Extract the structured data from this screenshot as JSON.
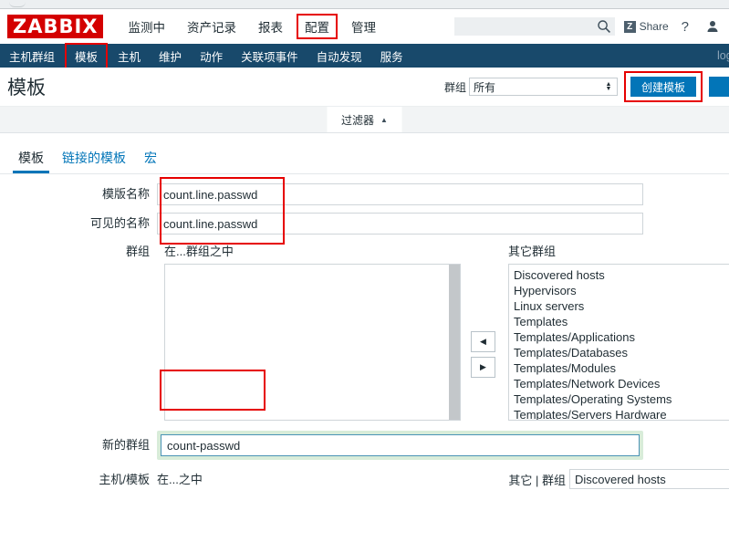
{
  "browser": {
    "chrome_visible": true
  },
  "header": {
    "logo": "ZABBIX",
    "menu": [
      {
        "label": "监测中",
        "highlighted": false
      },
      {
        "label": "资产记录",
        "highlighted": false
      },
      {
        "label": "报表",
        "highlighted": false
      },
      {
        "label": "配置",
        "highlighted": true
      },
      {
        "label": "管理",
        "highlighted": false
      }
    ],
    "search": {
      "value": "",
      "placeholder": ""
    },
    "share_label": "Share",
    "share_badge": "Z",
    "help_label": "?",
    "icons": {
      "search": "search-icon",
      "help": "question-mark-icon",
      "user": "user-icon"
    }
  },
  "subnav": {
    "items": [
      {
        "label": "主机群组",
        "active": false
      },
      {
        "label": "模板",
        "active": true
      },
      {
        "label": "主机",
        "active": false
      },
      {
        "label": "维护",
        "active": false
      },
      {
        "label": "动作",
        "active": false
      },
      {
        "label": "关联项事件",
        "active": false
      },
      {
        "label": "自动发现",
        "active": false
      },
      {
        "label": "服务",
        "active": false
      }
    ],
    "logout_label": "logout"
  },
  "title_row": {
    "page_title": "模板",
    "group_label": "群组",
    "group_value": "所有",
    "create_button": "创建模板"
  },
  "filter": {
    "label": "过滤器",
    "toggle_glyph": "▲"
  },
  "tabs": [
    {
      "label": "模板",
      "active": true
    },
    {
      "label": "链接的模板",
      "active": false
    },
    {
      "label": "宏",
      "active": false
    }
  ],
  "form": {
    "template_name": {
      "label": "模版名称",
      "value": "count.line.passwd"
    },
    "visible_name": {
      "label": "可见的名称",
      "value": "count.line.passwd"
    },
    "groups": {
      "label": "群组",
      "in_groups_title": "在...群组之中",
      "other_groups_title": "其它群组",
      "in_groups_items": [],
      "other_groups_items": [
        "Discovered hosts",
        "Hypervisors",
        "Linux servers",
        "Templates",
        "Templates/Applications",
        "Templates/Databases",
        "Templates/Modules",
        "Templates/Network Devices",
        "Templates/Operating Systems",
        "Templates/Servers Hardware"
      ],
      "move_left_glyph": "◀",
      "move_right_glyph": "▶"
    },
    "new_group": {
      "label": "新的群组",
      "value": "count-passwd",
      "focused": true
    },
    "hosts_templates": {
      "label": "主机/模板",
      "in_title": "在...之中",
      "other_label": "其它 | 群组",
      "other_value": "Discovered hosts"
    }
  },
  "colors": {
    "brand_red": "#d40000",
    "nav_blue": "#18496b",
    "accent_blue": "#0275b8",
    "annotation_red": "#e60000",
    "focus_green": "#d8ecd9",
    "focus_border": "#4a93b5"
  }
}
